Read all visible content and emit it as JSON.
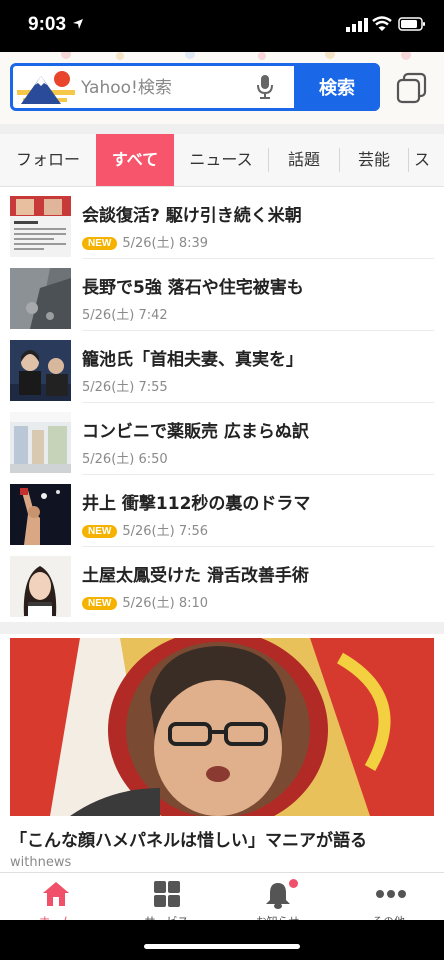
{
  "status_bar": {
    "time": "9:03"
  },
  "search": {
    "placeholder": "Yahoo!検索",
    "button_label": "検索"
  },
  "category_tabs": [
    "フォロー",
    "すべて",
    "ニュース",
    "話題",
    "芸能",
    "ス"
  ],
  "active_tab": "すべて",
  "news": [
    {
      "headline": "会談復活? 駆け引き続く米朝",
      "new": true,
      "date": "5/26(土) 8:39"
    },
    {
      "headline": "長野で5強 落石や住宅被害も",
      "new": false,
      "date": "5/26(土) 7:42"
    },
    {
      "headline": "籠池氏「首相夫妻、真実を」",
      "new": false,
      "date": "5/26(土) 7:55"
    },
    {
      "headline": "コンビニで薬販売 広まらぬ訳",
      "new": false,
      "date": "5/26(土) 6:50"
    },
    {
      "headline": "井上 衝撃112秒の裏のドラマ",
      "new": true,
      "date": "5/26(土) 7:56"
    },
    {
      "headline": "土屋太鳳受けた 滑舌改善手術",
      "new": true,
      "date": "5/26(土) 8:10"
    }
  ],
  "new_badge_label": "NEW",
  "feature": {
    "title": "「こんな顔ハメパネルは惜しい」マニアが語る",
    "source": "withnews"
  },
  "bottom_nav": [
    {
      "label": "ホーム",
      "icon": "home-icon"
    },
    {
      "label": "サービス",
      "icon": "grid-icon"
    },
    {
      "label": "お知らせ",
      "icon": "bell-icon"
    },
    {
      "label": "その他",
      "icon": "more-icon"
    }
  ],
  "colors": {
    "accent_blue": "#1a68e8",
    "active_tab_pink": "#f6556c",
    "new_badge": "#f5b300"
  }
}
